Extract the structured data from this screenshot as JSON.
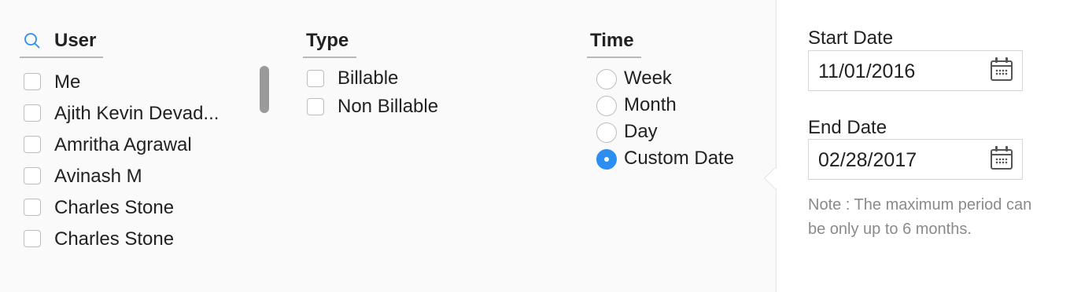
{
  "user": {
    "title": "User",
    "items": [
      "Me",
      "Ajith Kevin Devad...",
      "Amritha Agrawal",
      "Avinash M",
      "Charles Stone",
      "Charles Stone"
    ]
  },
  "type": {
    "title": "Type",
    "items": [
      "Billable",
      "Non Billable"
    ]
  },
  "time": {
    "title": "Time",
    "options": [
      "Week",
      "Month",
      "Day",
      "Custom Date"
    ],
    "selected": "Custom Date"
  },
  "dates": {
    "start_label": "Start Date",
    "start_value": "11/01/2016",
    "end_label": "End Date",
    "end_value": "02/28/2017",
    "note": "Note : The maximum period can be only up to 6 months."
  },
  "colors": {
    "accent": "#2b8ef0"
  }
}
